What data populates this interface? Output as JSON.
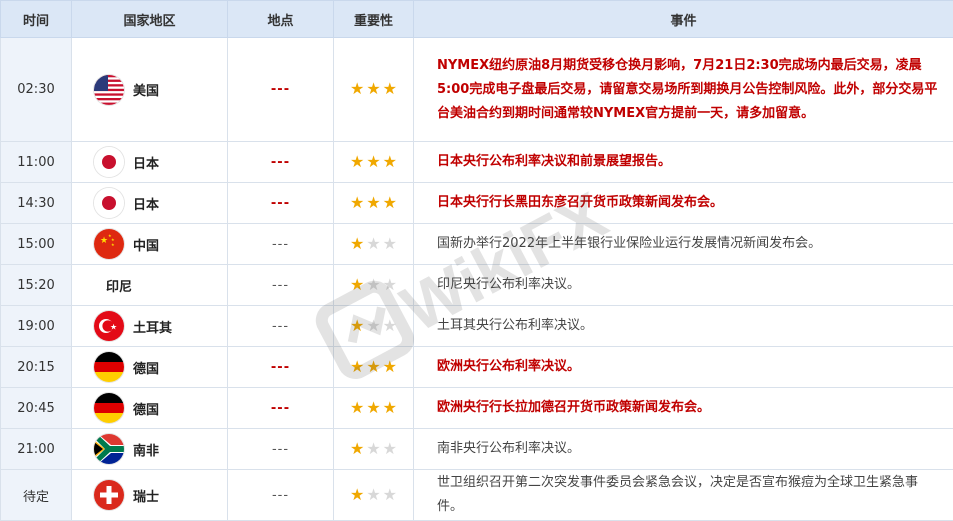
{
  "headers": {
    "time": "时间",
    "country": "国家地区",
    "place": "地点",
    "importance": "重要性",
    "event": "事件"
  },
  "watermark": "WikiFX",
  "colors": {
    "header_bg": "#dbe7f6",
    "time_bg": "#eef3fa",
    "highlight_text": "#c00000",
    "star_on": "#f0a800",
    "star_off": "#d8d8d8"
  },
  "rows": [
    {
      "time": "02:30",
      "country": "美国",
      "flag": "us-flag-icon",
      "place": "---",
      "stars": 3,
      "important": true,
      "event": "NYMEX纽约原油8月期货受移仓换月影响，7月21日2:30完成场内最后交易，凌晨5:00完成电子盘最后交易，请留意交易场所到期换月公告控制风险。此外，部分交易平台美油合约到期时间通常较NYMEX官方提前一天，请多加留意。"
    },
    {
      "time": "11:00",
      "country": "日本",
      "flag": "japan-flag-icon",
      "place": "---",
      "stars": 3,
      "important": true,
      "event": "日本央行公布利率决议和前景展望报告。"
    },
    {
      "time": "14:30",
      "country": "日本",
      "flag": "japan-flag-icon",
      "place": "---",
      "stars": 3,
      "important": true,
      "event": "日本央行行长黑田东彦召开货币政策新闻发布会。"
    },
    {
      "time": "15:00",
      "country": "中国",
      "flag": "china-flag-icon",
      "place": "---",
      "stars": 1,
      "important": false,
      "event": "国新办举行2022年上半年银行业保险业运行发展情况新闻发布会。"
    },
    {
      "time": "15:20",
      "country": "印尼",
      "flag": "",
      "place": "---",
      "stars": 1,
      "important": false,
      "event": "印尼央行公布利率决议。"
    },
    {
      "time": "19:00",
      "country": "土耳其",
      "flag": "turkey-flag-icon",
      "place": "---",
      "stars": 1,
      "important": false,
      "event": "土耳其央行公布利率决议。"
    },
    {
      "time": "20:15",
      "country": "德国",
      "flag": "germany-flag-icon",
      "place": "---",
      "stars": 3,
      "important": true,
      "event": "欧洲央行公布利率决议。"
    },
    {
      "time": "20:45",
      "country": "德国",
      "flag": "germany-flag-icon",
      "place": "---",
      "stars": 3,
      "important": true,
      "event": "欧洲央行行长拉加德召开货币政策新闻发布会。"
    },
    {
      "time": "21:00",
      "country": "南非",
      "flag": "south-africa-flag-icon",
      "place": "---",
      "stars": 1,
      "important": false,
      "event": "南非央行公布利率决议。"
    },
    {
      "time": "待定",
      "country": "瑞士",
      "flag": "switzerland-flag-icon",
      "place": "---",
      "stars": 1,
      "important": false,
      "event": "世卫组织召开第二次突发事件委员会紧急会议，决定是否宣布猴痘为全球卫生紧急事件。"
    }
  ]
}
